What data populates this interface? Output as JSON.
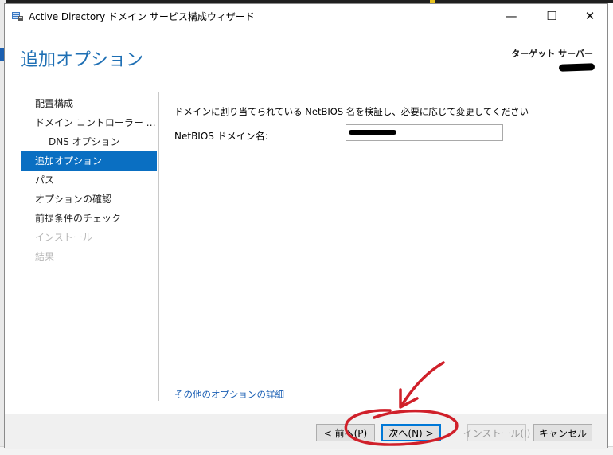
{
  "window": {
    "title": "Active Directory ドメイン サービス構成ウィザード",
    "caption": {
      "minimize": "—",
      "maximize": "☐",
      "close": "✕"
    }
  },
  "header": {
    "page_title": "追加オプション",
    "target_label": "ターゲット サーバー"
  },
  "nav": {
    "items": [
      {
        "label": "配置構成",
        "state": "normal"
      },
      {
        "label": "ドメイン コントローラー オプション",
        "state": "normal"
      },
      {
        "label": "DNS オプション",
        "state": "normal"
      },
      {
        "label": "追加オプション",
        "state": "active"
      },
      {
        "label": "パス",
        "state": "normal"
      },
      {
        "label": "オプションの確認",
        "state": "normal"
      },
      {
        "label": "前提条件のチェック",
        "state": "normal"
      },
      {
        "label": "インストール",
        "state": "disabled"
      },
      {
        "label": "結果",
        "state": "disabled"
      }
    ]
  },
  "main": {
    "description": "ドメインに割り当てられている NetBIOS 名を検証し、必要に応じて変更してください",
    "netbios_label": "NetBIOS ドメイン名:",
    "more_link": "その他のオプションの詳細"
  },
  "footer": {
    "prev_label": "< 前へ(P)",
    "next_label": "次へ(N) >",
    "install_label": "インストール(I)",
    "cancel_label": "キャンセル"
  },
  "colors": {
    "accent": "#0a6fc2",
    "title_blue": "#1e6fb4",
    "annotation_red": "#d0202a"
  }
}
